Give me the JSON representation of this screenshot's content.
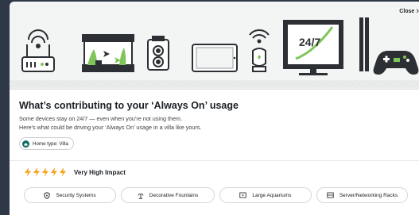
{
  "banner": {
    "close_label": "Close",
    "tv_text": "24/7"
  },
  "content": {
    "title": "What’s contributing to your ‘Always On’ usage",
    "subtitle_line1": "Some devices stay on 24/7 — even when you’re not using them.",
    "subtitle_line2": "Here’s what could be driving your ‘Always On’ usage in a villa like yours.",
    "home_type_chip": "Home type: Villa"
  },
  "impact": {
    "label": "Very High Impact",
    "level": 5,
    "bolt_icon": "lightning-bolt-icon",
    "bolt_color": "#f5a623"
  },
  "device_pills": [
    {
      "label": "Security Systems",
      "icon": "shield-icon"
    },
    {
      "label": "Decorative Fountains",
      "icon": "fountain-icon"
    },
    {
      "label": "Large Aquariums",
      "icon": "aquarium-icon"
    },
    {
      "label": "Server/Networking Racks",
      "icon": "server-icon"
    }
  ],
  "colors": {
    "accent_green": "#0b6b5f",
    "illustration_green": "#7fc65a",
    "background_dark": "#2e3847"
  }
}
